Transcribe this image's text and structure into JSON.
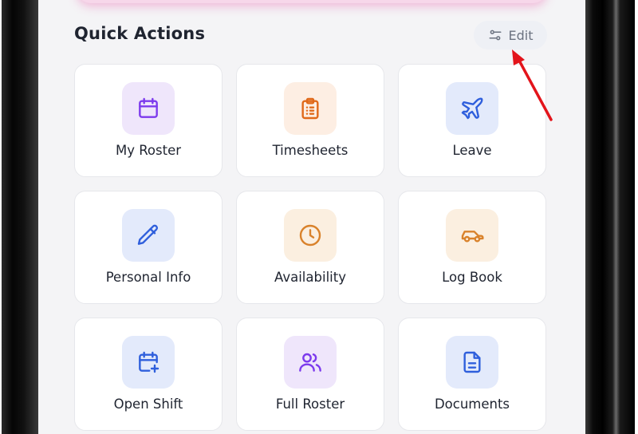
{
  "section": {
    "title": "Quick Actions"
  },
  "edit_button": {
    "label": "Edit"
  },
  "colors": {
    "purple": "#7c3aed",
    "purple_bg": "#efe6fb",
    "orange": "#e0691a",
    "orange_bg": "#fdeee3",
    "blue": "#2f5fdc",
    "blue_bg": "#e3eafb",
    "amber": "#d9822b",
    "amber_bg": "#fbefe0",
    "annotation_arrow": "#e3141b"
  },
  "tiles": [
    {
      "label": "My Roster",
      "icon": "calendar-icon",
      "tone": "purple"
    },
    {
      "label": "Timesheets",
      "icon": "clipboard-icon",
      "tone": "orange"
    },
    {
      "label": "Leave",
      "icon": "airplane-icon",
      "tone": "blue"
    },
    {
      "label": "Personal Info",
      "icon": "pencil-icon",
      "tone": "blue"
    },
    {
      "label": "Availability",
      "icon": "clock-icon",
      "tone": "amber"
    },
    {
      "label": "Log Book",
      "icon": "car-icon",
      "tone": "amber"
    },
    {
      "label": "Open Shift",
      "icon": "calendar-plus-icon",
      "tone": "blue"
    },
    {
      "label": "Full Roster",
      "icon": "users-icon",
      "tone": "purple"
    },
    {
      "label": "Documents",
      "icon": "document-icon",
      "tone": "blue"
    }
  ]
}
